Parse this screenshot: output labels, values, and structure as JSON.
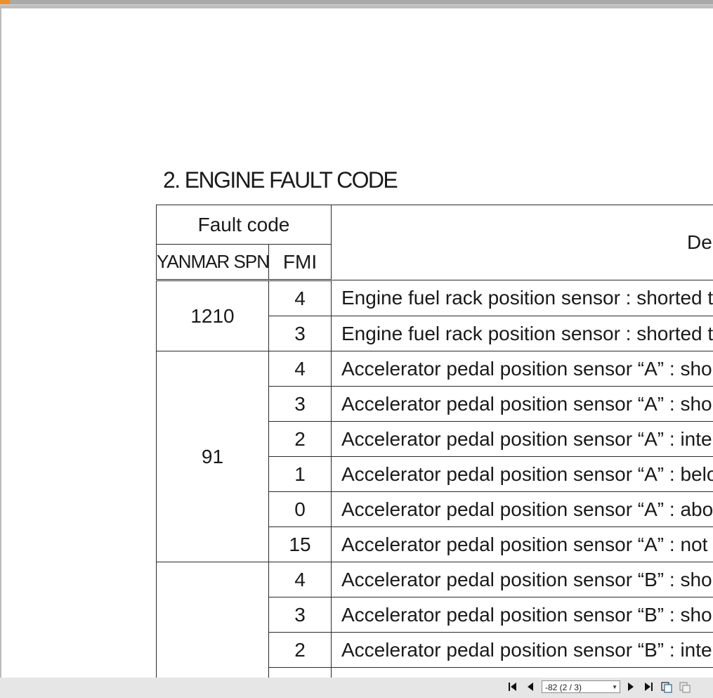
{
  "document": {
    "heading": "2. ENGINE FAULT CODE",
    "table": {
      "header": {
        "fault_code": "Fault code",
        "yanmar_spn": "YANMAR SPN",
        "fmi": "FMI",
        "description": "De"
      },
      "rows": [
        {
          "spn": "1210",
          "fmi": "4",
          "description": "Engine fuel rack position sensor : shorted to"
        },
        {
          "fmi": "3",
          "description": "Engine fuel rack position sensor : shorted to"
        },
        {
          "spn": "91",
          "fmi": "4",
          "description": "Accelerator pedal position sensor “A” : shor"
        },
        {
          "fmi": "3",
          "description": "Accelerator pedal position sensor “A” : shor"
        },
        {
          "fmi": "2",
          "description": "Accelerator pedal position sensor “A” : inter"
        },
        {
          "fmi": "1",
          "description": "Accelerator pedal position sensor “A” : belov"
        },
        {
          "fmi": "0",
          "description": "Accelerator pedal position sensor “A” : abov"
        },
        {
          "fmi": "15",
          "description": "Accelerator pedal position sensor “A” : not a"
        },
        {
          "spn": "",
          "fmi": "4",
          "description": "Accelerator pedal position sensor “B” : shor"
        },
        {
          "fmi": "3",
          "description": "Accelerator pedal position sensor “B” : shor"
        },
        {
          "fmi": "2",
          "description": "Accelerator pedal position sensor “B” : inter"
        },
        {
          "fmi": "",
          "description": ""
        }
      ]
    }
  },
  "viewer": {
    "page_select_value": "-82 (2 / 3)",
    "icons": {
      "first": "first-page-icon",
      "prev": "previous-page-icon",
      "next": "next-page-icon",
      "last": "last-page-icon",
      "view1": "view-mode-icon",
      "view2": "layout-icon"
    },
    "colors": {
      "accent": "#e8912f"
    }
  }
}
